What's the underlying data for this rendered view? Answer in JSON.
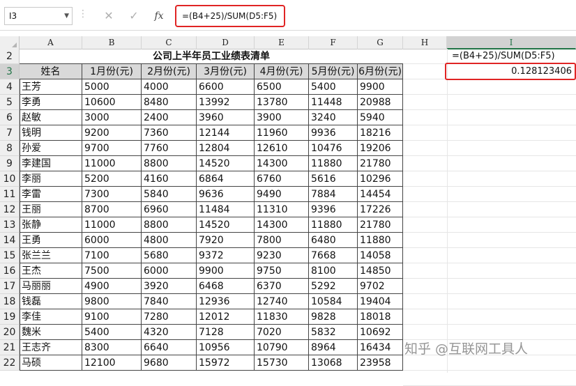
{
  "formula_bar": {
    "name_box": "I3",
    "cancel_glyph": "✕",
    "enter_glyph": "✓",
    "fx_label": "fx",
    "formula": "=(B4+25)/SUM(D5:F5)"
  },
  "columns": [
    "A",
    "B",
    "C",
    "D",
    "E",
    "F",
    "G",
    "H",
    "I"
  ],
  "rows": [
    "2",
    "3",
    "4",
    "5",
    "6",
    "7",
    "8",
    "9",
    "10",
    "11",
    "12",
    "13",
    "14",
    "15",
    "16",
    "17",
    "18",
    "19",
    "20",
    "21",
    "22"
  ],
  "table": {
    "title": "公司上半年员工业绩表清单",
    "headers": [
      "姓名",
      "1月份(元)",
      "2月份(元)",
      "3月份(元)",
      "4月份(元)",
      "5月份(元)",
      "6月份(元)"
    ],
    "rows": [
      [
        "王芳",
        "5000",
        "4000",
        "6600",
        "6500",
        "5400",
        "9900"
      ],
      [
        "李勇",
        "10600",
        "8480",
        "13992",
        "13780",
        "11448",
        "20988"
      ],
      [
        "赵敏",
        "3000",
        "2400",
        "3960",
        "3900",
        "3240",
        "5940"
      ],
      [
        "钱明",
        "9200",
        "7360",
        "12144",
        "11960",
        "9936",
        "18216"
      ],
      [
        "孙爱",
        "9700",
        "7760",
        "12804",
        "12610",
        "10476",
        "19206"
      ],
      [
        "李建国",
        "11000",
        "8800",
        "14520",
        "14300",
        "11880",
        "21780"
      ],
      [
        "李丽",
        "5200",
        "4160",
        "6864",
        "6760",
        "5616",
        "10296"
      ],
      [
        "李雷",
        "7300",
        "5840",
        "9636",
        "9490",
        "7884",
        "14454"
      ],
      [
        "王丽",
        "8700",
        "6960",
        "11484",
        "11310",
        "9396",
        "17226"
      ],
      [
        "张静",
        "11000",
        "8800",
        "14520",
        "14300",
        "11880",
        "21780"
      ],
      [
        "王勇",
        "6000",
        "4800",
        "7920",
        "7800",
        "6480",
        "11880"
      ],
      [
        "张兰兰",
        "7100",
        "5680",
        "9372",
        "9230",
        "7668",
        "14058"
      ],
      [
        "王杰",
        "7500",
        "6000",
        "9900",
        "9750",
        "8100",
        "14850"
      ],
      [
        "马丽丽",
        "4900",
        "3920",
        "6468",
        "6370",
        "5292",
        "9702"
      ],
      [
        "钱磊",
        "9800",
        "7840",
        "12936",
        "12740",
        "10584",
        "19404"
      ],
      [
        "李佳",
        "9100",
        "7280",
        "12012",
        "11830",
        "9828",
        "18018"
      ],
      [
        "魏米",
        "5400",
        "4320",
        "7128",
        "7020",
        "5832",
        "10692"
      ],
      [
        "王志齐",
        "8300",
        "6640",
        "10956",
        "10790",
        "8964",
        "16434"
      ],
      [
        "马硕",
        "12100",
        "9680",
        "15972",
        "15730",
        "13068",
        "23958"
      ]
    ]
  },
  "side_cells": {
    "i2_formula_text": "=(B4+25)/SUM(D5:F5)",
    "i3_result": "0.128123406"
  },
  "watermark": "知乎 @互联网工具人",
  "colors": {
    "highlight_red": "#e02424",
    "selected_header": "#217346"
  }
}
